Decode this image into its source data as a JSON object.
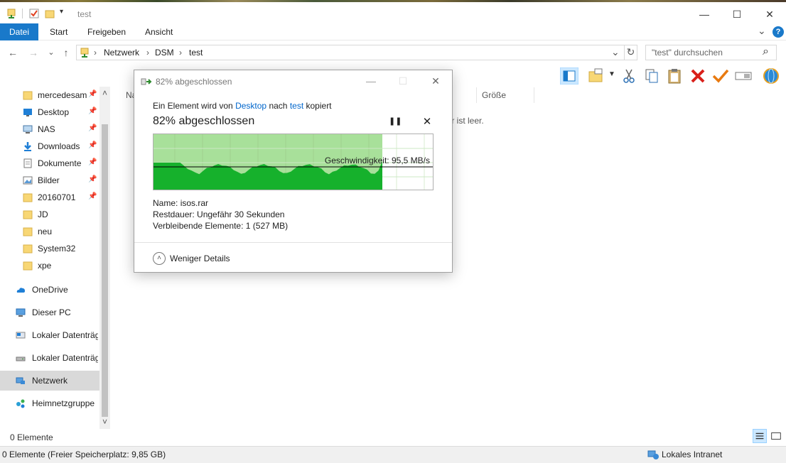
{
  "window": {
    "title": "test",
    "minimize_glyph": "—",
    "maximize_glyph": "☐",
    "close_glyph": "✕"
  },
  "ribbon": {
    "tabs": [
      {
        "label": "Datei",
        "active": true
      },
      {
        "label": "Start"
      },
      {
        "label": "Freigeben"
      },
      {
        "label": "Ansicht"
      }
    ],
    "help_glyph": "?",
    "expand_glyph": "⌄"
  },
  "address": {
    "back_glyph": "←",
    "forward_glyph": "→",
    "recent_glyph": "⌄",
    "up_glyph": "↑",
    "crumbs": [
      "Netzwerk",
      "DSM",
      "test"
    ],
    "separator": "›",
    "dropdown_glyph": "⌄",
    "refresh_glyph": "↻"
  },
  "search": {
    "placeholder": "\"test\" durchsuchen",
    "icon_glyph": "⌕"
  },
  "nav": {
    "pin_glyph": "📌",
    "items": [
      {
        "label": "mercedesamg",
        "icon": "folder-icon",
        "pinned": true
      },
      {
        "label": "Desktop",
        "icon": "desktop-icon",
        "pinned": true
      },
      {
        "label": "NAS",
        "icon": "computer-icon",
        "pinned": true
      },
      {
        "label": "Downloads",
        "icon": "download-icon",
        "pinned": true
      },
      {
        "label": "Dokumente",
        "icon": "documents-icon",
        "pinned": true
      },
      {
        "label": "Bilder",
        "icon": "pictures-icon",
        "pinned": true
      },
      {
        "label": "20160701",
        "icon": "folder-icon",
        "pinned": true
      },
      {
        "label": "JD",
        "icon": "folder-icon"
      },
      {
        "label": "neu",
        "icon": "folder-icon"
      },
      {
        "label": "System32",
        "icon": "folder-icon"
      },
      {
        "label": "xpe",
        "icon": "folder-icon"
      },
      {
        "label": "OneDrive",
        "icon": "onedrive-icon"
      },
      {
        "label": "Dieser PC",
        "icon": "this-pc-icon"
      },
      {
        "label": "Lokaler Datenträger (C:)",
        "icon": "local-disk-icon"
      },
      {
        "label": "Lokaler Datenträger (D:)",
        "icon": "drive-icon"
      },
      {
        "label": "Netzwerk",
        "icon": "network-icon",
        "selected": true
      },
      {
        "label": "Heimnetzgruppe",
        "icon": "homegroup-icon"
      }
    ],
    "scroll_up_glyph": "˄",
    "scroll_down_glyph": "˅"
  },
  "content": {
    "col_name": "Na",
    "col_size": "Größe",
    "empty_message": "ner ist leer."
  },
  "status": {
    "count": "0 Elemente",
    "bar": "0 Elemente (Freier Speicherplatz: 9,85 GB)",
    "zone": "Lokales Intranet"
  },
  "dialog": {
    "title": "82% abgeschlossen",
    "minimize_glyph": "—",
    "maximize_glyph": "☐",
    "close_glyph": "✕",
    "line_prefix": "Ein Element wird von",
    "line_source": "Desktop",
    "line_mid": "nach",
    "line_dest": "test",
    "line_suffix": "kopiert",
    "heading": "82% abgeschlossen",
    "pause_glyph": "❚❚",
    "stop_glyph": "✕",
    "speed": "Geschwindigkeit: 95,5 MB/s",
    "name_label": "Name:",
    "name_value": "isos.rar",
    "remaining_label": "Restdauer:",
    "remaining_value": "Ungefähr 30 Sekunden",
    "items_label": "Verbleibende Elemente:",
    "items_value": "1 (527 MB)",
    "less_details": "Weniger Details",
    "less_glyph": "˄",
    "progress": 0.82,
    "colors": {
      "done": "#a8e09a",
      "fill": "#16b12c",
      "line": "#000000",
      "grid": "#9fd08f"
    }
  }
}
